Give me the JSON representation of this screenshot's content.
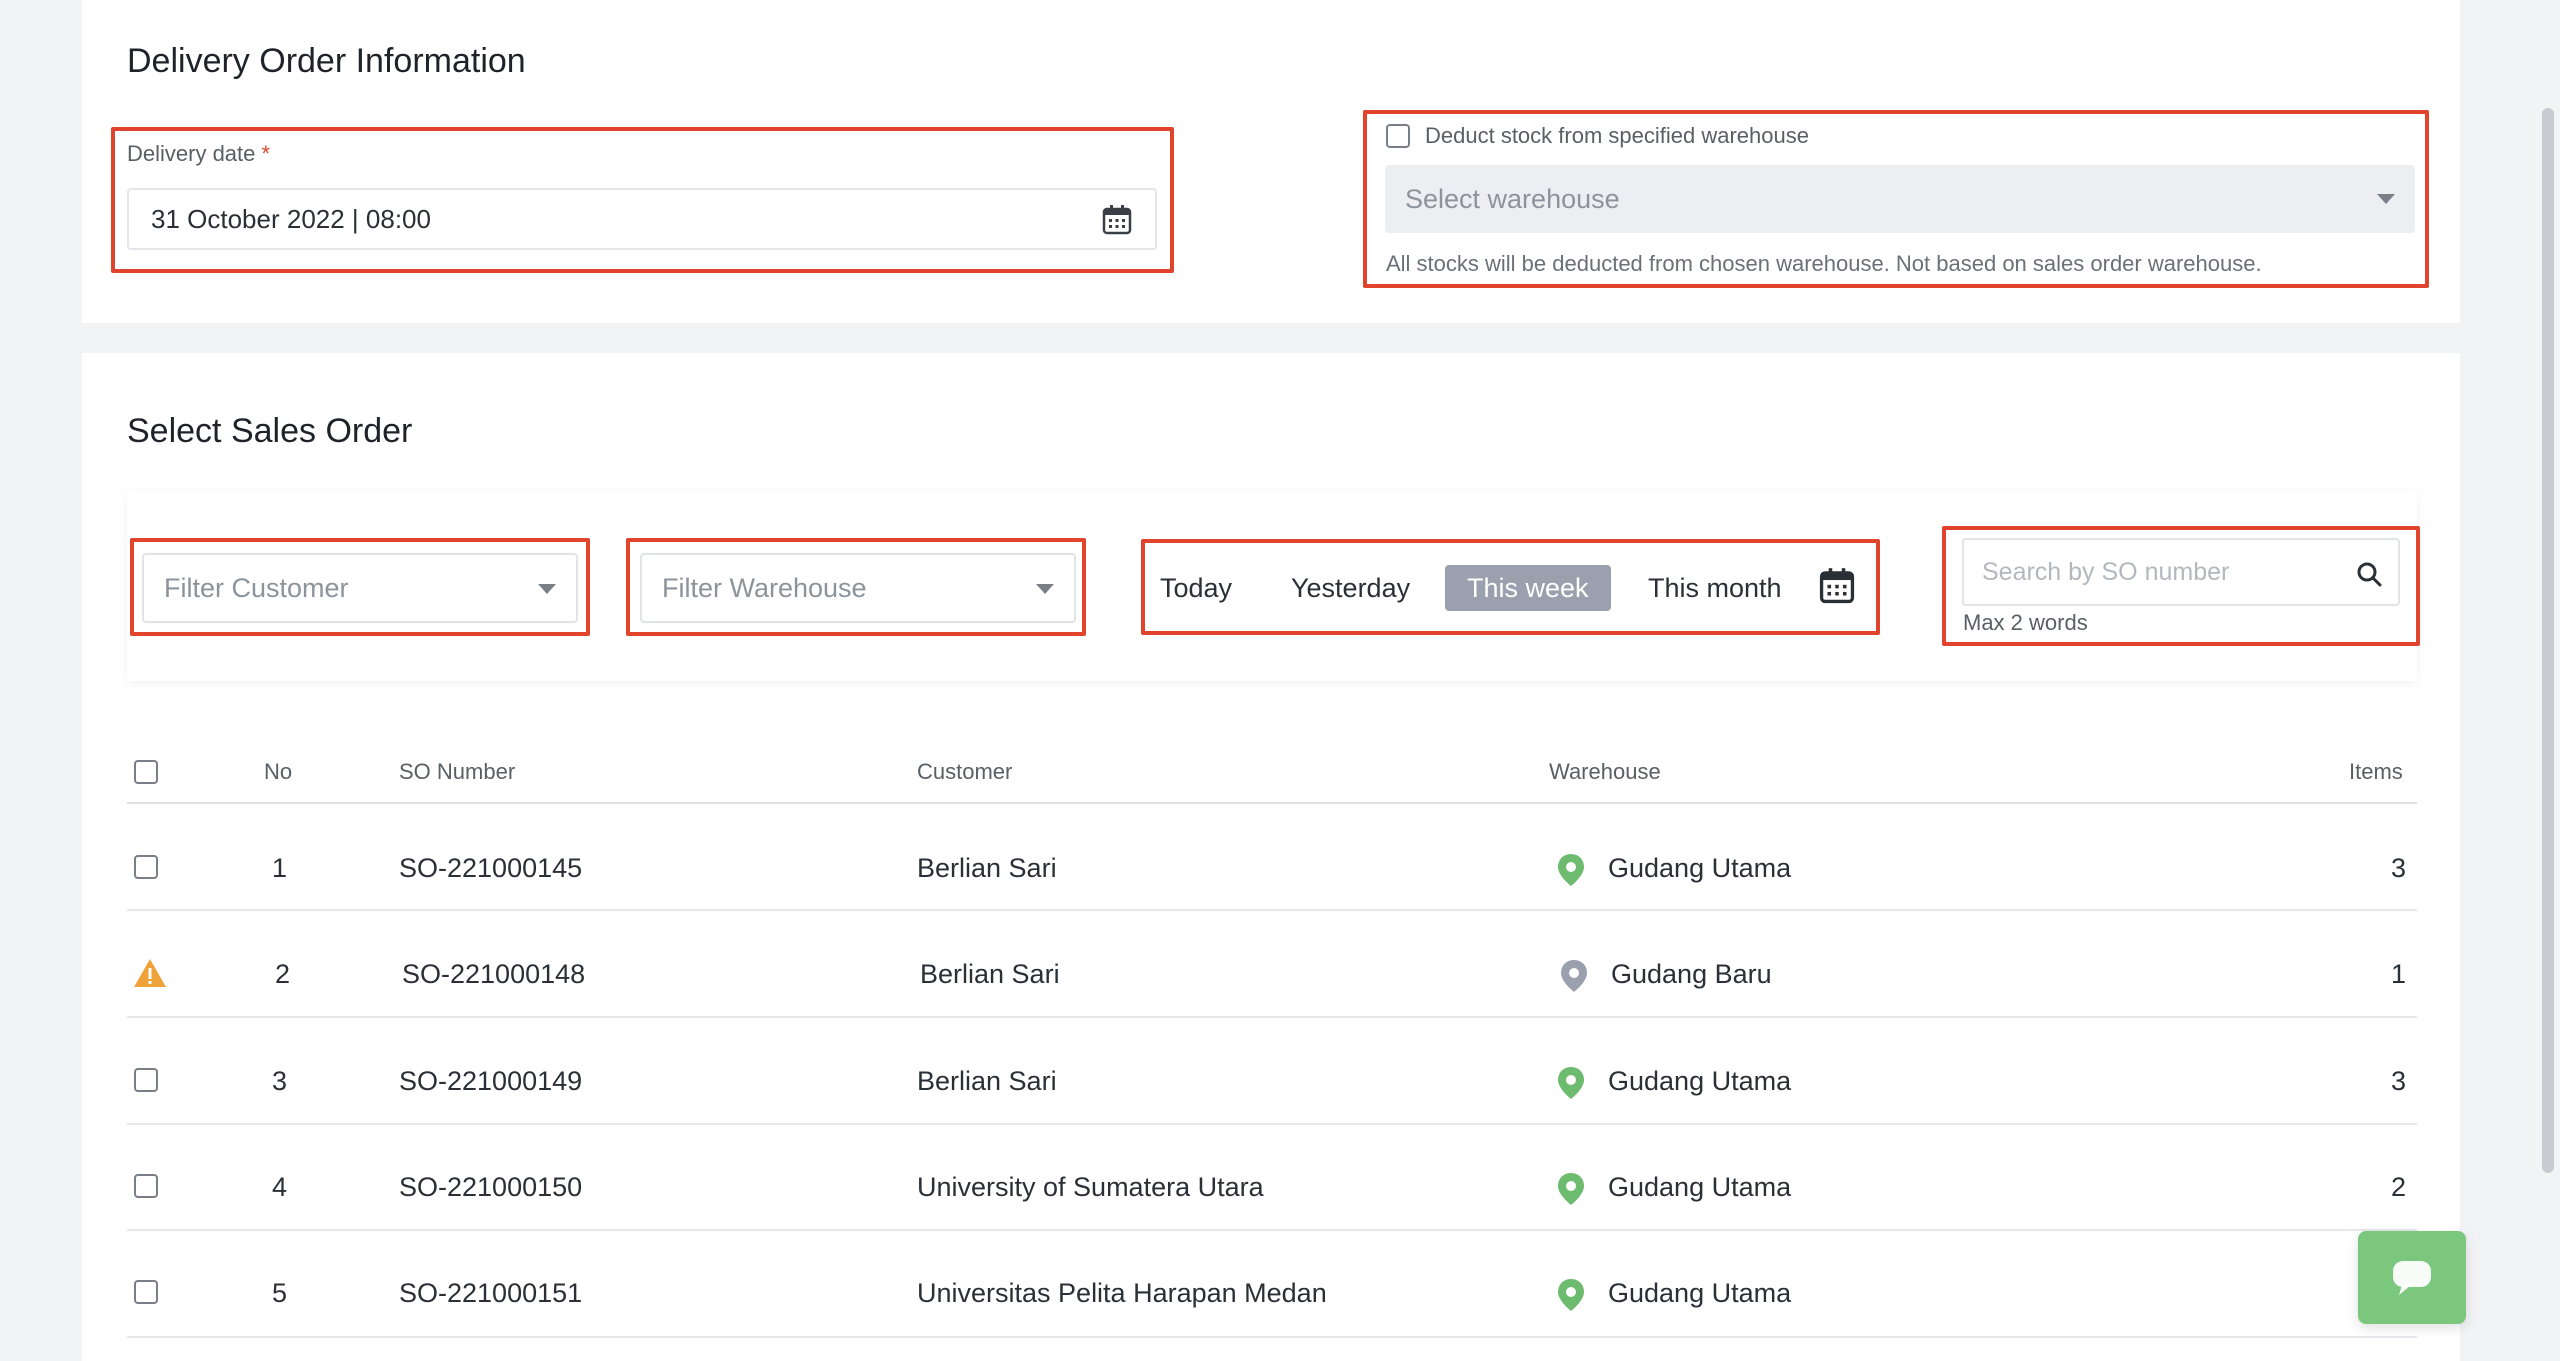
{
  "delivery_info": {
    "title": "Delivery Order Information",
    "date_label": "Delivery date",
    "required_mark": "*",
    "date_value": "31 October 2022 | 08:00",
    "deduct_label": "Deduct stock from specified warehouse",
    "deduct_checked": false,
    "warehouse_placeholder": "Select warehouse",
    "warehouse_hint": "All stocks will be deducted from chosen warehouse. Not based on sales order warehouse."
  },
  "sales_order": {
    "title": "Select Sales Order",
    "filter_customer": "Filter Customer",
    "filter_warehouse": "Filter Warehouse",
    "ranges": [
      "Today",
      "Yesterday",
      "This week",
      "This month"
    ],
    "active_range": "This week",
    "search_placeholder": "Search by SO number",
    "search_hint": "Max 2 words"
  },
  "table": {
    "headers": {
      "no": "No",
      "so_number": "SO Number",
      "customer": "Customer",
      "warehouse": "Warehouse",
      "items": "Items"
    },
    "rows": [
      {
        "no": "1",
        "so_number": "SO-221000145",
        "customer": "Berlian Sari",
        "warehouse": "Gudang Utama",
        "items": "3",
        "status": "selectable",
        "pin_color": "#6dbb6f"
      },
      {
        "no": "2",
        "so_number": "SO-221000148",
        "customer": "Berlian Sari",
        "warehouse": "Gudang Baru",
        "items": "1",
        "status": "warning",
        "pin_color": "#9aa0ad"
      },
      {
        "no": "3",
        "so_number": "SO-221000149",
        "customer": "Berlian Sari",
        "warehouse": "Gudang Utama",
        "items": "3",
        "status": "selectable",
        "pin_color": "#6dbb6f"
      },
      {
        "no": "4",
        "so_number": "SO-221000150",
        "customer": "University of Sumatera Utara",
        "warehouse": "Gudang Utama",
        "items": "2",
        "status": "selectable",
        "pin_color": "#6dbb6f"
      },
      {
        "no": "5",
        "so_number": "SO-221000151",
        "customer": "Universitas Pelita Harapan Medan",
        "warehouse": "Gudang Utama",
        "items": "",
        "status": "selectable",
        "pin_color": "#6dbb6f"
      }
    ]
  },
  "colors": {
    "highlight": "#e0442d",
    "active_range_bg": "#9aa0ad",
    "pin_green": "#6dbb6f",
    "pin_grey": "#9aa0ad",
    "warning": "#f0a23a",
    "chat_button": "#7bc77e"
  },
  "icons": {
    "date_picker": "calendar-icon",
    "dropdown": "chevron-down-icon",
    "search": "search-icon",
    "warehouse": "location-pin-icon",
    "warning": "warning-icon",
    "chat": "chat-icon"
  }
}
